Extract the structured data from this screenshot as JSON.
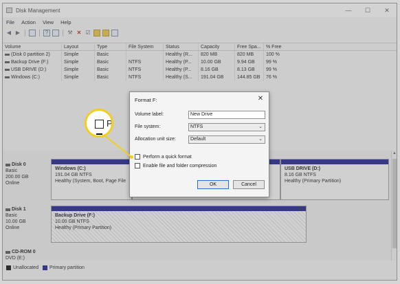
{
  "window": {
    "title": "Disk Management",
    "controls": {
      "minimize": "—",
      "maximize": "☐",
      "close": "✕"
    }
  },
  "menu": [
    "File",
    "Action",
    "View",
    "Help"
  ],
  "toolbar": {
    "icons": [
      "back-arrow-icon",
      "forward-arrow-icon",
      "disk-list-icon",
      "help-icon",
      "properties-icon",
      "wrench-icon",
      "delete-icon",
      "check-icon",
      "folder-icon",
      "open-folder-icon",
      "view-icon"
    ]
  },
  "volumes": {
    "headers": [
      "Volume",
      "Layout",
      "Type",
      "File System",
      "Status",
      "Capacity",
      "Free Spa...",
      "% Free"
    ],
    "rows": [
      [
        "(Disk 0 partition 2)",
        "Simple",
        "Basic",
        "",
        "Healthy (R...",
        "820 MB",
        "820 MB",
        "100 %"
      ],
      [
        "Backup Drive (F:)",
        "Simple",
        "Basic",
        "NTFS",
        "Healthy (P...",
        "10.00 GB",
        "9.94 GB",
        "99 %"
      ],
      [
        "USB DRIVE (D:)",
        "Simple",
        "Basic",
        "NTFS",
        "Healthy (P...",
        "8.16 GB",
        "8.13 GB",
        "99 %"
      ],
      [
        "Windows (C:)",
        "Simple",
        "Basic",
        "NTFS",
        "Healthy (S...",
        "191.04 GB",
        "144.85 GB",
        "76 %"
      ]
    ]
  },
  "disks": [
    {
      "name": "Disk 0",
      "type": "Basic",
      "size": "200.00 GB",
      "state": "Online",
      "partitions": [
        {
          "title": "Windows  (C:)",
          "size": "191.04 GB NTFS",
          "status": "Healthy (System, Boot, Page File"
        },
        {
          "title": "USB DRIVE  (D:)",
          "size": "8.16 GB NTFS",
          "status": "Healthy (Primary Partition)"
        }
      ]
    },
    {
      "name": "Disk 1",
      "type": "Basic",
      "size": "10.00 GB",
      "state": "Online",
      "partitions": [
        {
          "title": "Backup Drive  (F:)",
          "size": "10.00 GB NTFS",
          "status": "Healthy (Primary Partition)"
        }
      ]
    },
    {
      "name": "CD-ROM 0",
      "type": "DVD (E:)"
    }
  ],
  "legend": {
    "unallocated": "Unallocated",
    "primary": "Primary partition",
    "unallocated_color": "#111111",
    "primary_color": "#1c1f8a"
  },
  "dialog": {
    "title": "Format F:",
    "close": "✕",
    "volume_label_label": "Volume label:",
    "volume_label_value": "New Drive",
    "file_system_label": "File system:",
    "file_system_value": "NTFS",
    "alloc_label": "Allocation unit size:",
    "alloc_value": "Default",
    "quick_format": "Perform a quick format",
    "compression": "Enable file and folder compression",
    "ok": "OK",
    "cancel": "Cancel"
  },
  "callout": {
    "text": "Pe",
    "accent": "#f2cf1e"
  }
}
